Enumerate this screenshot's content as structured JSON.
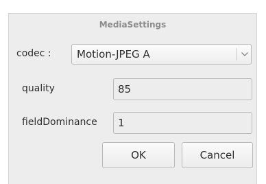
{
  "dialog": {
    "title": "MediaSettings"
  },
  "codec": {
    "label": "codec :",
    "value": "Motion-JPEG A",
    "dropdown_icon": "chevron-down-icon"
  },
  "quality": {
    "label": "quality",
    "value": "85"
  },
  "field_dominance": {
    "label": "fieldDominance",
    "value": "1"
  },
  "buttons": {
    "ok_label": "OK",
    "cancel_label": "Cancel"
  }
}
